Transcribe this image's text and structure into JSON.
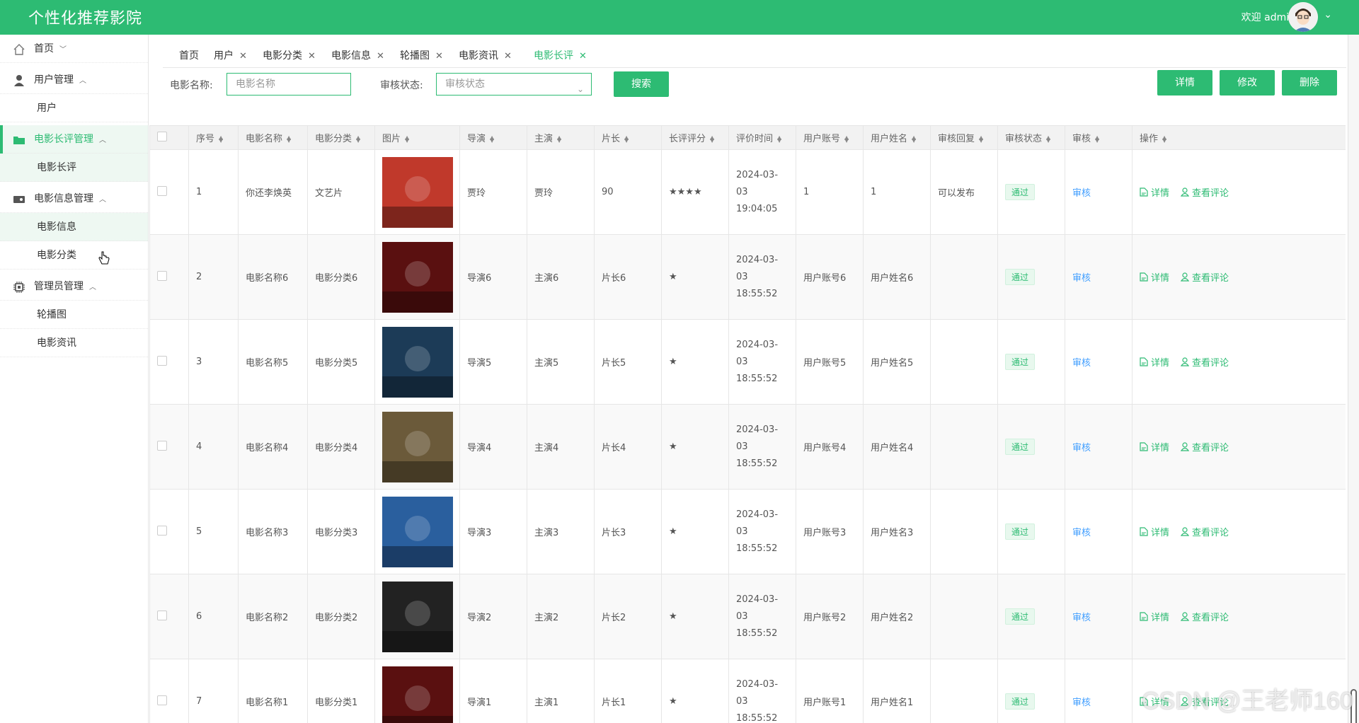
{
  "header": {
    "app_title": "个性化推荐影院",
    "welcome": "欢迎 admin"
  },
  "sidebar": {
    "home": "首页",
    "user_mgmt": "用户管理",
    "user": "用户",
    "review_mgmt": "电影长评管理",
    "review": "电影长评",
    "movie_mgmt": "电影信息管理",
    "movie_info": "电影信息",
    "movie_cat": "电影分类",
    "admin_mgmt": "管理员管理",
    "carousel": "轮播图",
    "news": "电影资讯"
  },
  "tabs": [
    "首页",
    "用户",
    "电影分类",
    "电影信息",
    "轮播图",
    "电影资讯",
    "电影长评"
  ],
  "search": {
    "name_label": "电影名称:",
    "name_placeholder": "电影名称",
    "status_label": "审核状态:",
    "status_placeholder": "审核状态",
    "search_btn": "搜索"
  },
  "actions": {
    "detail": "详情",
    "edit": "修改",
    "delete": "删除"
  },
  "table": {
    "headers": [
      "序号",
      "电影名称",
      "电影分类",
      "图片",
      "导演",
      "主演",
      "片长",
      "长评评分",
      "评价时间",
      "用户账号",
      "用户姓名",
      "审核回复",
      "审核状态",
      "审核",
      "操作"
    ],
    "row_actions": {
      "detail": "详情",
      "comments": "查看评论"
    },
    "rows": [
      {
        "no": "1",
        "name": "你还李焕英",
        "cat": "文艺片",
        "director": "贾玲",
        "actor": "贾玲",
        "length": "90",
        "rating": "★★★★",
        "date": "2024-03-03",
        "time": "19:04:05",
        "account": "1",
        "uname": "1",
        "reply": "可以发布",
        "status": "通过",
        "audit": "审核",
        "poster": "#c0392b"
      },
      {
        "no": "2",
        "name": "电影名称6",
        "cat": "电影分类6",
        "director": "导演6",
        "actor": "主演6",
        "length": "片长6",
        "rating": "★",
        "date": "2024-03-03",
        "time": "18:55:52",
        "account": "用户账号6",
        "uname": "用户姓名6",
        "reply": "",
        "status": "通过",
        "audit": "审核",
        "poster": "#5a1010"
      },
      {
        "no": "3",
        "name": "电影名称5",
        "cat": "电影分类5",
        "director": "导演5",
        "actor": "主演5",
        "length": "片长5",
        "rating": "★",
        "date": "2024-03-03",
        "time": "18:55:52",
        "account": "用户账号5",
        "uname": "用户姓名5",
        "reply": "",
        "status": "通过",
        "audit": "审核",
        "poster": "#1c3b57"
      },
      {
        "no": "4",
        "name": "电影名称4",
        "cat": "电影分类4",
        "director": "导演4",
        "actor": "主演4",
        "length": "片长4",
        "rating": "★",
        "date": "2024-03-03",
        "time": "18:55:52",
        "account": "用户账号4",
        "uname": "用户姓名4",
        "reply": "",
        "status": "通过",
        "audit": "审核",
        "poster": "#6b5a3a"
      },
      {
        "no": "5",
        "name": "电影名称3",
        "cat": "电影分类3",
        "director": "导演3",
        "actor": "主演3",
        "length": "片长3",
        "rating": "★",
        "date": "2024-03-03",
        "time": "18:55:52",
        "account": "用户账号3",
        "uname": "用户姓名3",
        "reply": "",
        "status": "通过",
        "audit": "审核",
        "poster": "#2a5f9e"
      },
      {
        "no": "6",
        "name": "电影名称2",
        "cat": "电影分类2",
        "director": "导演2",
        "actor": "主演2",
        "length": "片长2",
        "rating": "★",
        "date": "2024-03-03",
        "time": "18:55:52",
        "account": "用户账号2",
        "uname": "用户姓名2",
        "reply": "",
        "status": "通过",
        "audit": "审核",
        "poster": "#222222"
      },
      {
        "no": "7",
        "name": "电影名称1",
        "cat": "电影分类1",
        "director": "导演1",
        "actor": "主演1",
        "length": "片长1",
        "rating": "★",
        "date": "2024-03-03",
        "time": "18:55:52",
        "account": "用户账号1",
        "uname": "用户姓名1",
        "reply": "",
        "status": "通过",
        "audit": "审核",
        "poster": "#5a1010"
      }
    ]
  },
  "watermark": "CSDN @王老师160",
  "colors": {
    "accent": "#2dbb73",
    "link_blue": "#409eff"
  }
}
